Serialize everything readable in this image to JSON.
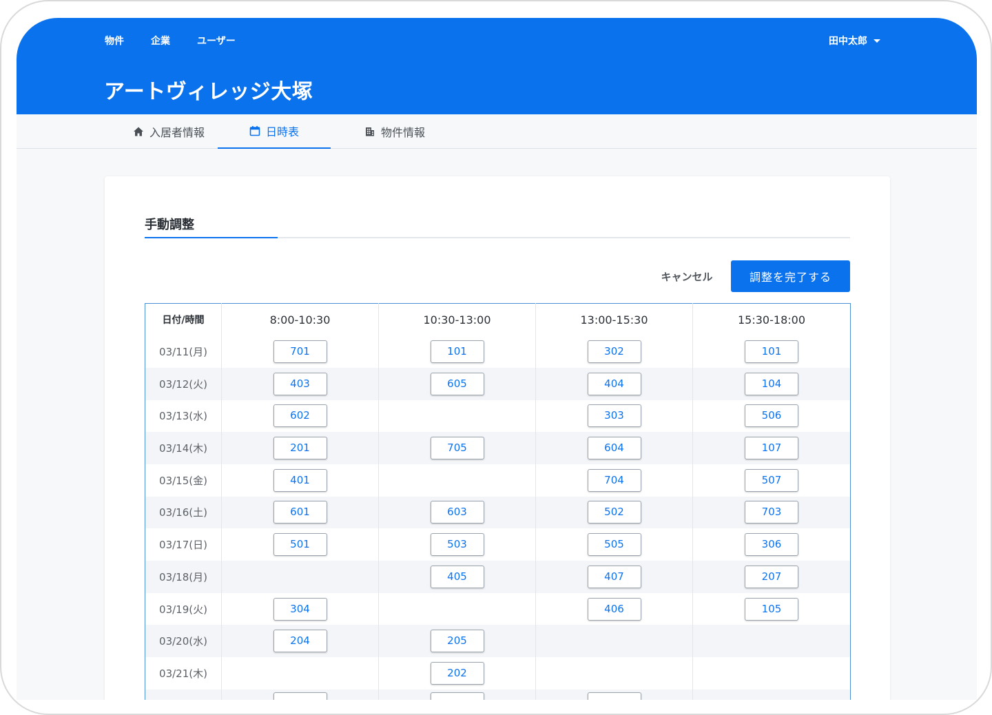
{
  "nav": {
    "items": [
      "物件",
      "企業",
      "ユーザー"
    ],
    "user_name": "田中太郎"
  },
  "header": {
    "title": "アートヴィレッジ大塚"
  },
  "tabs": [
    {
      "label": "入居者情報",
      "icon": "home-icon"
    },
    {
      "label": "日時表",
      "icon": "calendar-icon",
      "active": true
    },
    {
      "label": "物件情報",
      "icon": "building-icon"
    }
  ],
  "section": {
    "title": "手動調整"
  },
  "actions": {
    "cancel_label": "キャンセル",
    "complete_label": "調整を完了する"
  },
  "colors": {
    "primary": "#0b72ee",
    "header_bg": "#0b72ee",
    "row_alt": "#f3f5f8"
  },
  "schedule": {
    "date_header": "日付/時間",
    "slots": [
      "8:00-10:30",
      "10:30-13:00",
      "13:00-15:30",
      "15:30-18:00"
    ],
    "rows": [
      {
        "date": "03/11(月)",
        "rooms": [
          "701",
          "101",
          "302",
          "101"
        ]
      },
      {
        "date": "03/12(火)",
        "rooms": [
          "403",
          "605",
          "404",
          "104"
        ]
      },
      {
        "date": "03/13(水)",
        "rooms": [
          "602",
          "",
          "303",
          "506"
        ]
      },
      {
        "date": "03/14(木)",
        "rooms": [
          "201",
          "705",
          "604",
          "107"
        ]
      },
      {
        "date": "03/15(金)",
        "rooms": [
          "401",
          "",
          "704",
          "507"
        ]
      },
      {
        "date": "03/16(土)",
        "rooms": [
          "601",
          "603",
          "502",
          "703"
        ]
      },
      {
        "date": "03/17(日)",
        "rooms": [
          "501",
          "503",
          "505",
          "306"
        ]
      },
      {
        "date": "03/18(月)",
        "rooms": [
          "",
          "405",
          "407",
          "207"
        ]
      },
      {
        "date": "03/19(火)",
        "rooms": [
          "304",
          "",
          "406",
          "105"
        ]
      },
      {
        "date": "03/20(水)",
        "rooms": [
          "204",
          "205",
          "",
          ""
        ]
      },
      {
        "date": "03/21(木)",
        "rooms": [
          "",
          "202",
          "",
          ""
        ]
      },
      {
        "date": "",
        "rooms": [
          "",
          "",
          "",
          ""
        ]
      }
    ]
  }
}
